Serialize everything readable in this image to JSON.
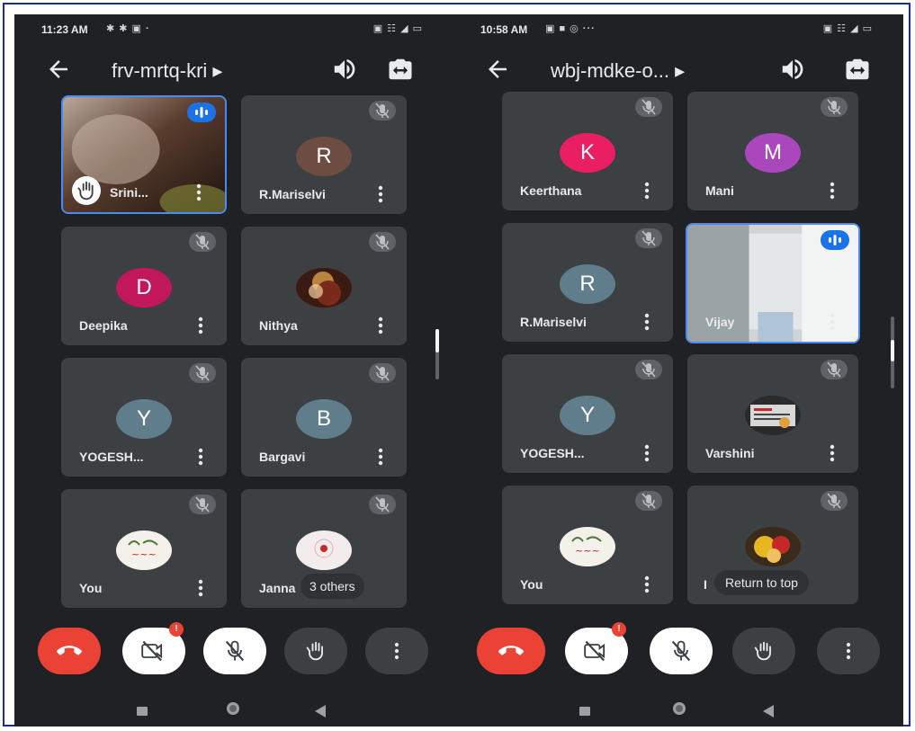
{
  "left": {
    "status": {
      "time": "11:23 AM",
      "notifications": "✱ ✱ ▣ ·",
      "system": "▣ ☷ ◢ ▭"
    },
    "meeting_code": "frv-mrtq-kri ▸",
    "tiles": [
      {
        "name": "Srini...",
        "type": "video"
      },
      {
        "name": "R.Mariselvi",
        "initial": "R",
        "color": "#6d4c41"
      },
      {
        "name": "Deepika",
        "initial": "D",
        "color": "#c2185b"
      },
      {
        "name": "Nithya",
        "type": "photo"
      },
      {
        "name": "YOGESH...",
        "initial": "Y",
        "color": "#607d8b"
      },
      {
        "name": "Bargavi",
        "initial": "B",
        "color": "#607d8b"
      },
      {
        "name": "You",
        "type": "photo"
      },
      {
        "name": "Janna",
        "type": "photo"
      }
    ],
    "others_pill": "3 others",
    "cam_badge": "!"
  },
  "right": {
    "status": {
      "time": "10:58 AM",
      "notifications": "▣ ■ ◎ ···",
      "system": "▣ ☷ ◢ ▭"
    },
    "meeting_code": "wbj-mdke-o... ▸",
    "tiles": [
      {
        "name": "Keerthana",
        "initial": "K",
        "color": "#e91e63"
      },
      {
        "name": "Mani",
        "initial": "M",
        "color": "#ab47bc"
      },
      {
        "name": "R.Mariselvi",
        "initial": "R",
        "color": "#607d8b"
      },
      {
        "name": "Vijay",
        "type": "video"
      },
      {
        "name": "YOGESH...",
        "initial": "Y",
        "color": "#607d8b"
      },
      {
        "name": "Varshini",
        "type": "photo"
      },
      {
        "name": "You",
        "type": "photo"
      },
      {
        "name": "I",
        "type": "photo"
      }
    ],
    "return_pill": "Return to top",
    "cam_badge": "!"
  },
  "colors": {
    "background": "#202124",
    "tile": "#3c4043",
    "end_call": "#ea4335",
    "active_speaker": "#1a73e8"
  }
}
